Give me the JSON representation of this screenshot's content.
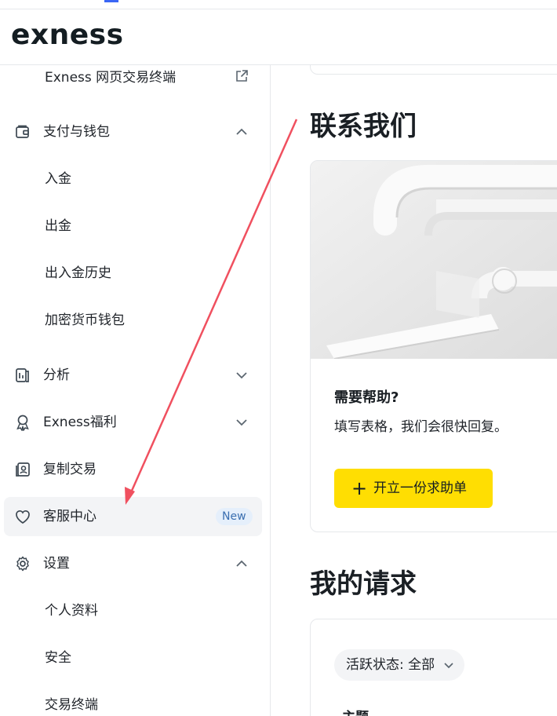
{
  "brand": {
    "logo": "exness"
  },
  "sidebar": {
    "items": [
      {
        "label": "Exness 网页交易终端",
        "type": "sub",
        "icon": "external-link-icon"
      },
      {
        "label": "支付与钱包",
        "type": "group",
        "icon": "wallet-icon",
        "expanded": true
      },
      {
        "label": "入金",
        "type": "sub"
      },
      {
        "label": "出金",
        "type": "sub"
      },
      {
        "label": "出入金历史",
        "type": "sub"
      },
      {
        "label": "加密货币钱包",
        "type": "sub"
      },
      {
        "label": "分析",
        "type": "group",
        "icon": "analytics-icon",
        "expanded": false
      },
      {
        "label": "Exness福利",
        "type": "group",
        "icon": "award-icon",
        "expanded": false
      },
      {
        "label": "复制交易",
        "type": "item",
        "icon": "copy-trading-icon"
      },
      {
        "label": "客服中心",
        "type": "item",
        "icon": "heart-icon",
        "active": true,
        "badge": "New"
      },
      {
        "label": "设置",
        "type": "group",
        "icon": "gear-icon",
        "expanded": true
      },
      {
        "label": "个人资料",
        "type": "sub"
      },
      {
        "label": "安全",
        "type": "sub"
      },
      {
        "label": "交易终端",
        "type": "sub"
      }
    ]
  },
  "main": {
    "contact": {
      "title": "联系我们",
      "card_title": "需要帮助?",
      "card_text": "填写表格，我们会很快回复。",
      "button_label": "开立一份求助单",
      "button_icon": "plus-icon"
    },
    "requests": {
      "title": "我的请求",
      "filter_label": "活跃状态: 全部",
      "column_header": "主题"
    }
  },
  "colors": {
    "accent_yellow": "#ffde02",
    "badge_bg": "#e5effb",
    "badge_text": "#3b6fb0",
    "active_bg": "#f3f4f6",
    "annotation_arrow": "#f0505f"
  }
}
